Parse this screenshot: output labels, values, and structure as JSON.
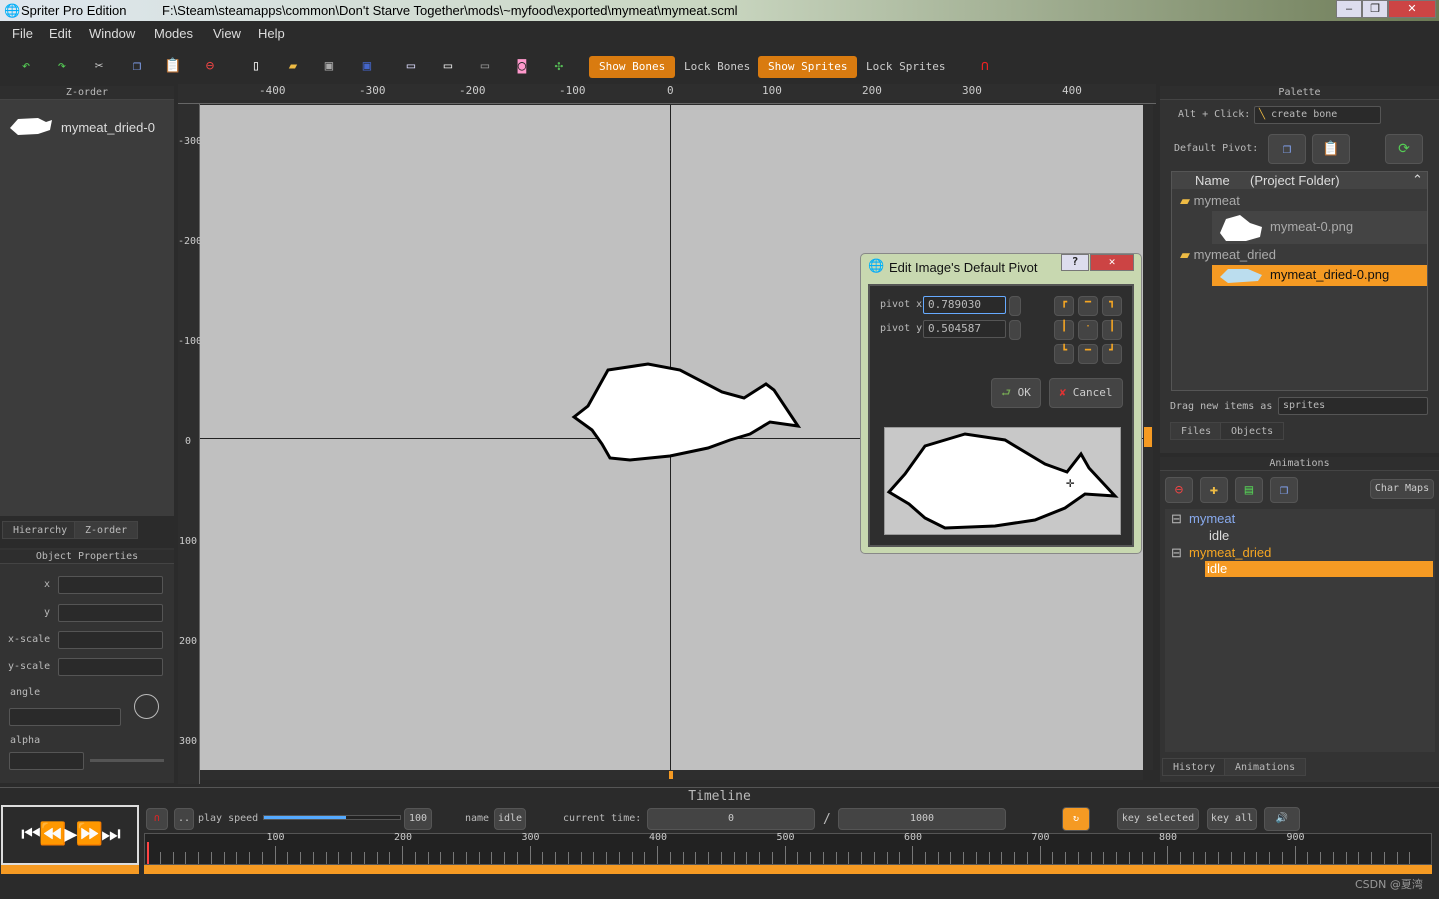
{
  "window": {
    "app": "Spriter Pro Edition",
    "path": "F:\\Steam\\steamapps\\common\\Don't Starve Together\\mods\\~myfood\\exported\\mymeat\\mymeat.scml"
  },
  "menu": [
    "File",
    "Edit",
    "Window",
    "Modes",
    "View",
    "Help"
  ],
  "toolbar": {
    "show_bones": "Show Bones",
    "lock_bones": "Lock Bones",
    "show_sprites": "Show Sprites",
    "lock_sprites": "Lock Sprites"
  },
  "zorder": {
    "title": "Z-order",
    "items": [
      "mymeat_dried-0"
    ],
    "tabs": [
      "Hierarchy",
      "Z-order"
    ]
  },
  "object_properties": {
    "title": "Object Properties",
    "labels": [
      "x",
      "y",
      "x-scale",
      "y-scale",
      "angle",
      "alpha"
    ]
  },
  "ruler": {
    "x": [
      "-400",
      "-300",
      "-200",
      "-100",
      "0",
      "100",
      "200",
      "300",
      "400"
    ],
    "y": [
      "-300",
      "-200",
      "-100",
      "0",
      "100",
      "200",
      "300"
    ]
  },
  "dialog": {
    "title": "Edit Image's Default Pivot",
    "help": "?",
    "pivot_x_label": "pivot x",
    "pivot_x": "0.789030",
    "pivot_y_label": "pivot y",
    "pivot_y": "0.504587",
    "ok": "OK",
    "cancel": "Cancel"
  },
  "palette": {
    "title": "Palette",
    "alt_click": "Alt + Click:",
    "alt_action": "create bone",
    "default_pivot": "Default Pivot:",
    "col_name": "Name",
    "col_folder": "(Project Folder)",
    "tree": [
      {
        "label": "mymeat",
        "type": "folder"
      },
      {
        "label": "mymeat-0.png",
        "type": "file"
      },
      {
        "label": "mymeat_dried",
        "type": "folder"
      },
      {
        "label": "mymeat_dried-0.png",
        "type": "file",
        "selected": true
      }
    ],
    "drag_label": "Drag new items as",
    "drag_value": "sprites",
    "tabs": [
      "Files",
      "Objects"
    ]
  },
  "animations": {
    "title": "Animations",
    "char_maps": "Char Maps",
    "tree": [
      {
        "label": "mymeat",
        "type": "entity"
      },
      {
        "label": "idle",
        "type": "anim"
      },
      {
        "label": "mymeat_dried",
        "type": "entity"
      },
      {
        "label": "idle",
        "type": "anim",
        "selected": true
      }
    ],
    "tabs": [
      "History",
      "Animations"
    ]
  },
  "timeline": {
    "title": "Timeline",
    "play_speed_label": "play speed",
    "play_speed": "100",
    "play_speed_fraction": 0.6,
    "name_label": "name",
    "name": "idle",
    "current_time_label": "current time:",
    "current_time": "0",
    "sep": "/",
    "length": "1000",
    "key_selected": "key selected",
    "key_all": "key all",
    "ticks": [
      "100",
      "200",
      "300",
      "400",
      "500",
      "600",
      "700",
      "800",
      "900"
    ]
  },
  "watermark": "CSDN @夏湾",
  "colors": {
    "accent": "#f59a23",
    "canvas": "#c0c0c0"
  }
}
